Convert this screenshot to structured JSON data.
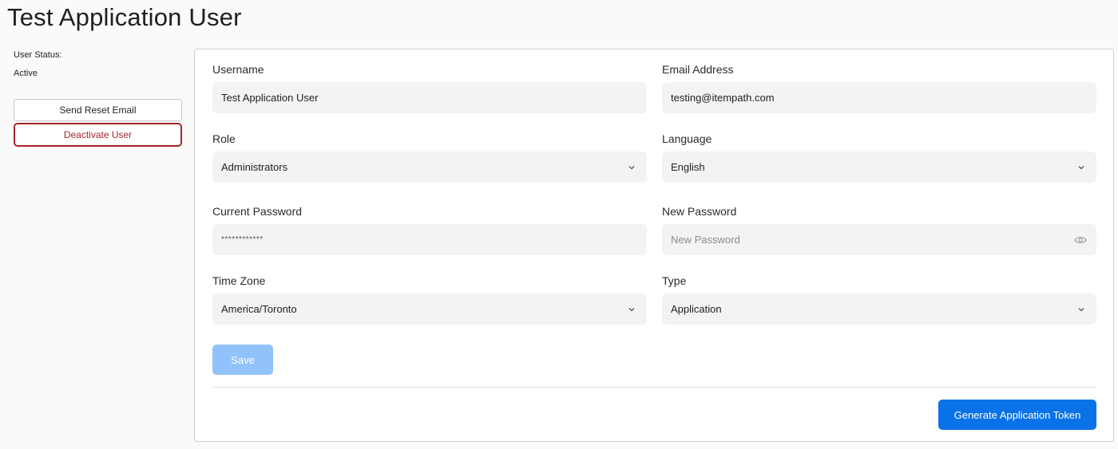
{
  "page": {
    "title": "Test Application User"
  },
  "sidebar": {
    "status_label": "User Status:",
    "status_value": "Active",
    "reset_email_label": "Send Reset Email",
    "deactivate_label": "Deactivate User"
  },
  "form": {
    "username": {
      "label": "Username",
      "value": "Test Application User"
    },
    "email": {
      "label": "Email Address",
      "value": "testing@itempath.com"
    },
    "role": {
      "label": "Role",
      "value": "Administrators"
    },
    "language": {
      "label": "Language",
      "value": "English"
    },
    "current_password": {
      "label": "Current Password",
      "value": "************"
    },
    "new_password": {
      "label": "New Password",
      "placeholder": "New Password"
    },
    "time_zone": {
      "label": "Time Zone",
      "value": "America/Toronto"
    },
    "type": {
      "label": "Type",
      "value": "Application"
    }
  },
  "actions": {
    "save_label": "Save",
    "generate_token_label": "Generate Application Token"
  },
  "colors": {
    "primary": "#0a72e8",
    "primary_disabled": "#92c2fb",
    "danger": "#a3262b"
  }
}
